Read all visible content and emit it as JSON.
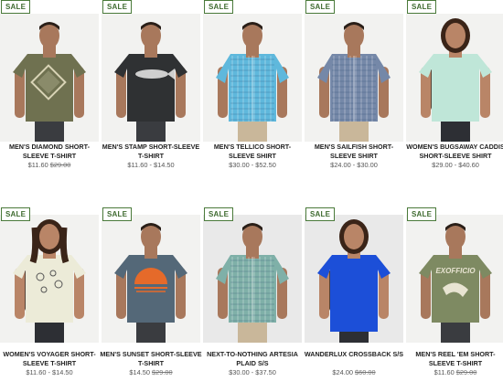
{
  "badge_label": "SALE",
  "products": [
    {
      "name": "MEN'S DIAMOND SHORT-SLEEVE T-SHIRT",
      "price": "$11.60",
      "old_price": "$29.00",
      "sale": true,
      "shirt_color": "#6f7150",
      "graphic": "diamond-print"
    },
    {
      "name": "MEN'S STAMP SHORT-SLEEVE T-SHIRT",
      "price": "$11.60 - $14.50",
      "old_price": "",
      "sale": true,
      "shirt_color": "#2f3133",
      "graphic": "fish-print"
    },
    {
      "name": "MEN'S TELLICO SHORT-SLEEVE SHIRT",
      "price": "$30.00 - $52.50",
      "old_price": "",
      "sale": true,
      "shirt_color": "#5fb8dc",
      "graphic": "plaid"
    },
    {
      "name": "MEN'S SAILFISH SHORT-SLEEVE SHIRT",
      "price": "$24.00 - $30.00",
      "old_price": "",
      "sale": true,
      "shirt_color": "#7588a8",
      "graphic": "plaid"
    },
    {
      "name": "WOMEN'S BUGSAWAY CADDIS SHORT-SLEEVE SHIRT",
      "price": "$29.00 - $40.60",
      "old_price": "",
      "sale": true,
      "shirt_color": "#bfe6d8",
      "graphic": "none"
    },
    {
      "name": "WOMEN'S VOYAGER SHORT-SLEEVE T-SHIRT",
      "price": "$11.60 - $14.50",
      "old_price": "",
      "sale": true,
      "shirt_color": "#ecebd8",
      "graphic": "bug-print"
    },
    {
      "name": "MEN'S SUNSET SHORT-SLEEVE T-SHIRT",
      "price": "$14.50",
      "old_price": "$29.00",
      "sale": true,
      "shirt_color": "#546878",
      "graphic": "sunset-print"
    },
    {
      "name": "NEXT-TO-NOTHING ARTESIA PLAID S/S",
      "price": "$30.00 - $37.50",
      "old_price": "",
      "sale": true,
      "shirt_color": "#7fb0a8",
      "graphic": "plaid"
    },
    {
      "name": "WANDERLUX CROSSBACK S/S",
      "price": "$24.00",
      "old_price": "$60.00",
      "sale": true,
      "shirt_color": "#1c4fd8",
      "graphic": "none"
    },
    {
      "name": "MEN'S REEL 'EM SHORT-SLEEVE T-SHIRT",
      "price": "$11.60",
      "old_price": "$29.00",
      "sale": true,
      "shirt_color": "#7e8a62",
      "graphic": "exofficio-print"
    }
  ]
}
